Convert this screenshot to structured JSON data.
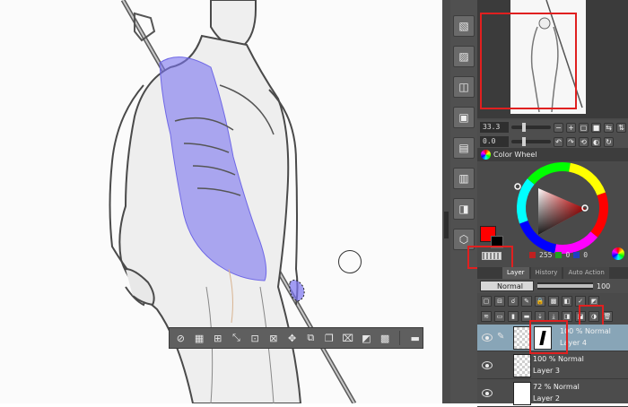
{
  "navigator": {
    "zoom": "33.3",
    "rotation": "0.0"
  },
  "color_wheel": {
    "tab_label": "Color Wheel",
    "main_color": "#ff0000",
    "sub_color": "#000000",
    "r": "255",
    "g": "0",
    "b": "0"
  },
  "layer_panel": {
    "tabs": [
      "Layer",
      "History",
      "Auto Action"
    ],
    "blend_mode": "Normal",
    "opacity": "100",
    "layers": [
      {
        "line1": "100 % Normal",
        "line2": "Layer 4",
        "selected": true
      },
      {
        "line1": "100 % Normal",
        "line2": "Layer 3",
        "selected": false
      },
      {
        "line1": "72 % Normal",
        "line2": "Layer 2",
        "selected": false
      }
    ]
  },
  "selection_toolbar": {
    "tools": [
      "deselect-icon",
      "invert-icon",
      "grow-icon",
      "shrink-icon",
      "reduce-icon",
      "shrink-2-icon",
      "transform-icon",
      "copy-icon",
      "paste-icon",
      "erase-icon",
      "fill-icon",
      "clear-icon",
      "tone-icon",
      "settings-icon"
    ]
  }
}
